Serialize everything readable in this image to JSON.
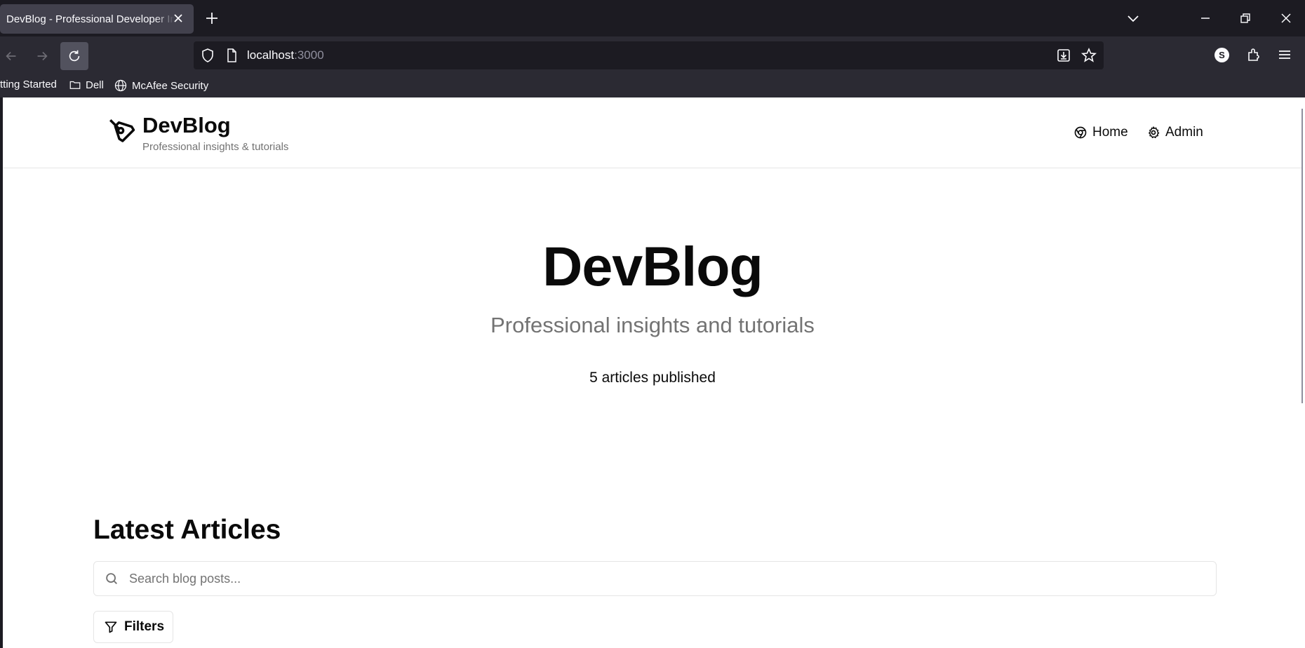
{
  "browser": {
    "tab_title": "DevBlog - Professional Developer Insights",
    "url_host": "localhost",
    "url_port": ":3000",
    "bookmarks": [
      "tting Started",
      "Dell",
      "McAfee Security"
    ],
    "profile_initial": "S"
  },
  "site": {
    "brand": "DevBlog",
    "tagline": "Professional insights & tutorials",
    "nav": [
      {
        "label": "Home",
        "icon": "chrome-icon"
      },
      {
        "label": "Admin",
        "icon": "gear-icon"
      }
    ]
  },
  "hero": {
    "title": "DevBlog",
    "subtitle": "Professional insights and tutorials",
    "count_text": "5 articles published"
  },
  "articles": {
    "section_title": "Latest Articles",
    "search_placeholder": "Search blog posts...",
    "filters_label": "Filters"
  },
  "colors": {
    "chrome_dark": "#1c1b22",
    "chrome_toolbar": "#2b2a33",
    "text_primary": "#0a0a0a",
    "text_muted": "#737373",
    "border": "#e5e5e5"
  }
}
